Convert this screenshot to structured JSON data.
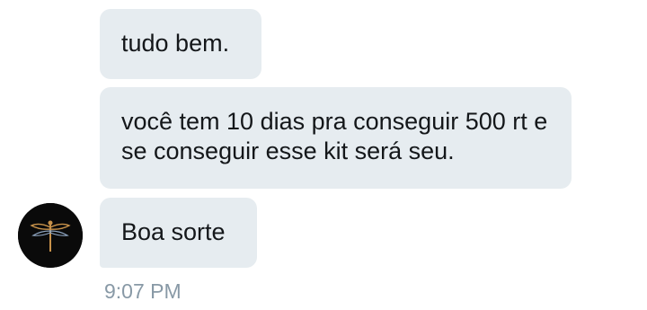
{
  "conversation": {
    "messages": [
      {
        "text": "tudo bem.",
        "sender": "them"
      },
      {
        "text": "você tem 10 dias pra conseguir 500 rt e se conseguir esse kit será seu.",
        "sender": "them"
      },
      {
        "text": "Boa sorte",
        "sender": "them"
      }
    ],
    "timestamp": "9:07 PM",
    "avatar": {
      "icon": "dragonfly-icon",
      "background": "#0a0a0a",
      "accent": "#c8924a"
    }
  },
  "colors": {
    "bubble_bg": "#e6ecf0",
    "bubble_text": "#14171a",
    "timestamp": "#8899a6"
  }
}
